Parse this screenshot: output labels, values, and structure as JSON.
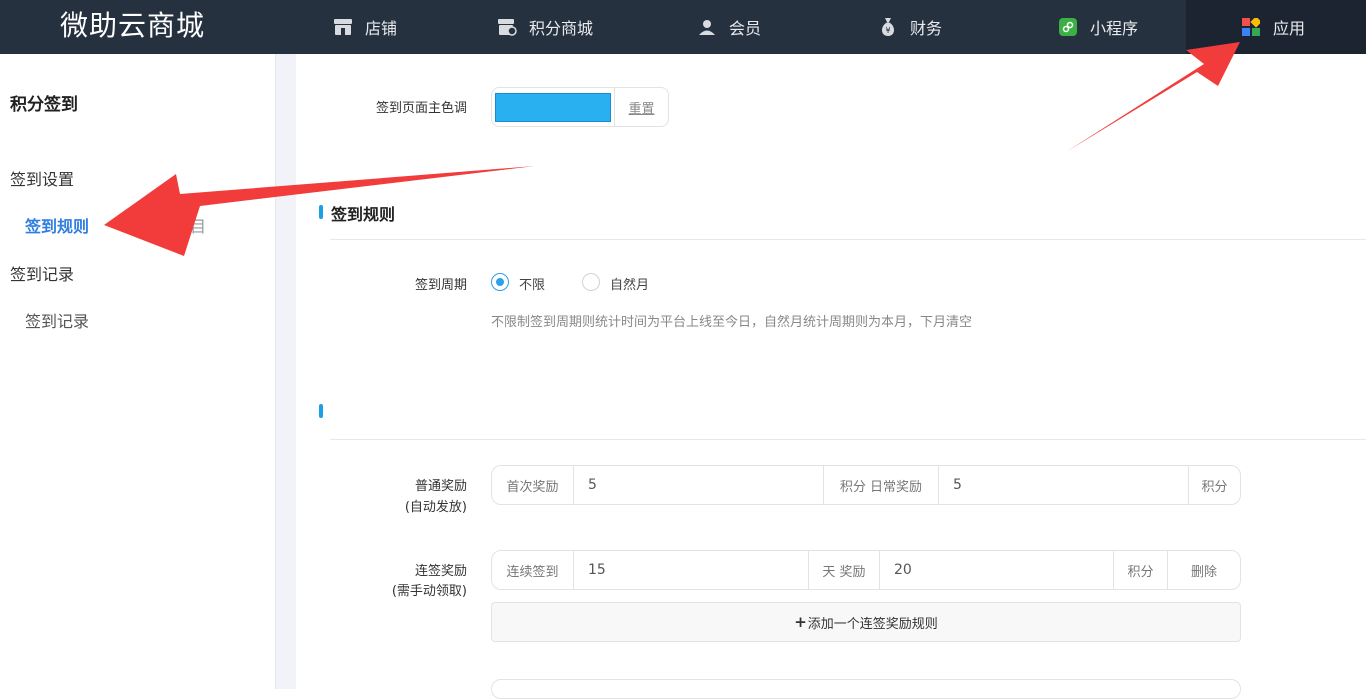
{
  "app": {
    "title": "微助云商城"
  },
  "nav": {
    "items": [
      {
        "label": "店铺",
        "icon": "store-icon"
      },
      {
        "label": "积分商城",
        "icon": "points-mall-icon"
      },
      {
        "label": "会员",
        "icon": "member-icon"
      },
      {
        "label": "财务",
        "icon": "money-bag-icon"
      },
      {
        "label": "小程序",
        "icon": "mini-program-icon"
      },
      {
        "label": "应用",
        "icon": "apps-icon"
      }
    ],
    "active": "应用"
  },
  "sidebar": {
    "title": "积分签到",
    "groups": [
      {
        "label": "签到设置",
        "items": [
          {
            "label": "签到规则",
            "active": true
          }
        ]
      },
      {
        "label": "签到记录",
        "items": [
          {
            "label": "签到记录",
            "active": false
          }
        ]
      }
    ],
    "hidden_fragment": "目"
  },
  "theme": {
    "label": "签到页面主色调",
    "color": "#29b0f0",
    "reset_label": "重置"
  },
  "rules": {
    "section_title": "签到规则",
    "cycle_label": "签到周期",
    "cycle_options": [
      "不限",
      "自然月"
    ],
    "cycle_selected": "不限",
    "cycle_hint": "不限制签到周期则统计时间为平台上线至今日，自然月统计周期则为本月，下月清空"
  },
  "rewards": {
    "normal_label": "普通奖励",
    "normal_sub": "(自动发放)",
    "first_reward_label": "首次奖励",
    "first_reward_value": "5",
    "points_unit_daily": "积分 日常奖励",
    "daily_reward_value": "5",
    "points_unit": "积分",
    "streak_label": "连签奖励",
    "streak_sub": "(需手动领取)",
    "streak_prefix": "连续签到",
    "streak_days": "15",
    "streak_mid": "天 奖励",
    "streak_points": "20",
    "streak_unit": "积分",
    "delete_label": "删除",
    "add_rule_label": "添加一个连签奖励规则"
  },
  "colors": {
    "accent": "#2f7ee0",
    "topbar": "#263140",
    "arrow": "#f23b3b"
  }
}
